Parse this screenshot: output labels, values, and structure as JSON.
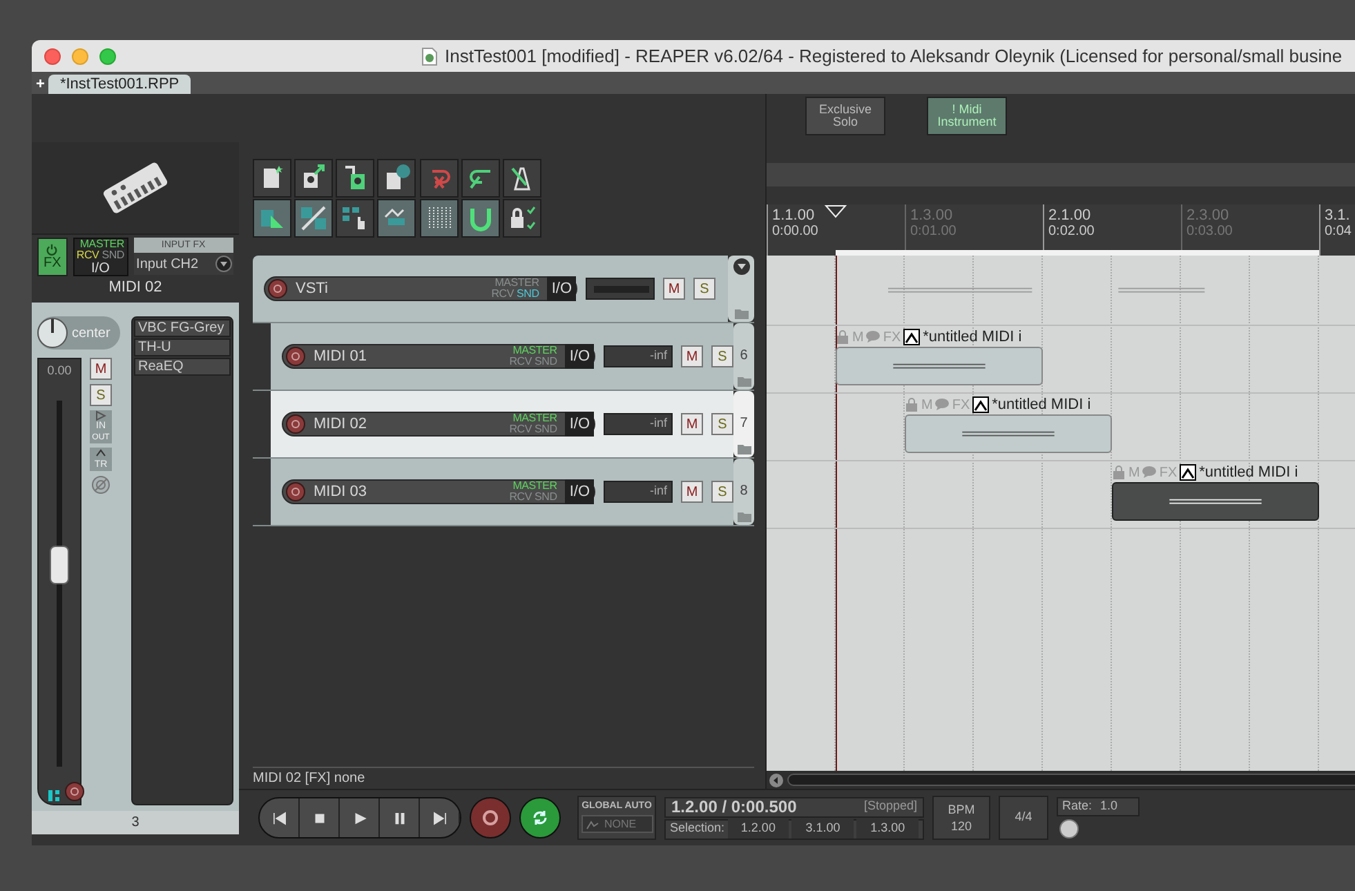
{
  "window": {
    "title": "InstTest001 [modified] - REAPER v6.02/64 - Registered to Aleksandr Oleynik (Licensed for personal/small busine"
  },
  "new_tab": "+",
  "project_tabs": [
    {
      "label": "*InstTest001.RPP",
      "selected": true
    }
  ],
  "mixer_strip": {
    "fx_label": "FX",
    "fx_on": true,
    "routing": [
      {
        "label": "MASTER",
        "on": true
      },
      {
        "label": "RCV",
        "on": true
      },
      {
        "label": "SND",
        "on": false
      }
    ],
    "io": "I/O",
    "input_fx": "INPUT FX",
    "input": "Input CH2",
    "name": "MIDI 02",
    "pan": "center",
    "volume": "0.00",
    "fader": {
      "level": 0.55
    },
    "mute": "M",
    "solo": "S",
    "in": "IN",
    "out": "OUT",
    "tr": "TR",
    "fx_chain": [
      "VBC FG-Grey",
      "TH-U",
      "ReaEQ"
    ],
    "number": "3"
  },
  "toolbar": [
    {
      "on": false
    },
    {
      "on": false
    },
    {
      "on": false
    },
    {
      "on": false
    },
    {
      "on": false
    },
    {
      "on": false
    },
    {
      "on": false
    },
    {
      "on": true
    },
    {
      "on": true
    },
    {
      "on": false
    },
    {
      "on": true
    },
    {
      "on": true
    },
    {
      "on": true
    },
    {
      "on": false
    }
  ],
  "toggle_buttons": [
    {
      "lines": [
        "Exclusive",
        "Solo"
      ],
      "on": false
    },
    {
      "lines": [
        "! Midi",
        "Instrument"
      ],
      "on": true
    }
  ],
  "tracks": [
    {
      "kind": "folder",
      "name": "VSTi",
      "selected": false,
      "io": "I/O",
      "mute": "M",
      "solo": "S",
      "routing": [
        {
          "label": "MASTER",
          "on": false
        },
        {
          "label": "RCV",
          "on": false
        },
        {
          "label": "SND",
          "on": true
        }
      ]
    },
    {
      "kind": "child",
      "name": "MIDI 01",
      "number": "6",
      "meter": "-inf",
      "selected": false,
      "io": "I/O",
      "mute": "M",
      "solo": "S",
      "routing": [
        {
          "label": "MASTER",
          "on": true
        },
        {
          "label": "RCV",
          "on": false
        },
        {
          "label": "SND",
          "on": false
        }
      ]
    },
    {
      "kind": "child",
      "name": "MIDI 02",
      "number": "7",
      "meter": "-inf",
      "selected": true,
      "io": "I/O",
      "mute": "M",
      "solo": "S",
      "routing": [
        {
          "label": "MASTER",
          "on": true
        },
        {
          "label": "RCV",
          "on": false
        },
        {
          "label": "SND",
          "on": false
        }
      ]
    },
    {
      "kind": "child",
      "name": "MIDI 03",
      "number": "8",
      "meter": "-inf",
      "selected": false,
      "io": "I/O",
      "mute": "M",
      "solo": "S",
      "routing": [
        {
          "label": "MASTER",
          "on": true
        },
        {
          "label": "RCV",
          "on": false
        },
        {
          "label": "SND",
          "on": false
        }
      ]
    }
  ],
  "ruler": [
    {
      "bar": "1.1.00",
      "time": "0:00.00",
      "major": true
    },
    {
      "bar": "1.3.00",
      "time": "0:01.00",
      "major": false
    },
    {
      "bar": "2.1.00",
      "time": "0:02.00",
      "major": true
    },
    {
      "bar": "2.3.00",
      "time": "0:03.00",
      "major": false
    },
    {
      "bar": "3.1.",
      "time": "0:04",
      "major": true
    }
  ],
  "items": [
    {
      "name": "*untitled MIDI i",
      "mute": "M",
      "fx": "FX",
      "selected": false
    },
    {
      "name": "*untitled MIDI i",
      "mute": "M",
      "fx": "FX",
      "selected": false
    },
    {
      "name": "*untitled MIDI i",
      "mute": "M",
      "fx": "FX",
      "selected": true
    }
  ],
  "status": "MIDI 02 [FX] none",
  "transport": {
    "repeat": true,
    "global_auto": "GLOBAL AUTO",
    "auto_mode": "NONE",
    "position": "1.2.00 / 0:00.500",
    "state": "[Stopped]",
    "selection_label": "Selection:",
    "selection": [
      "1.2.00",
      "3.1.00",
      "1.3.00"
    ],
    "bpm_label": "BPM",
    "bpm": "120",
    "time_signature": "4/4",
    "rate_label": "Rate:",
    "rate": "1.0"
  }
}
